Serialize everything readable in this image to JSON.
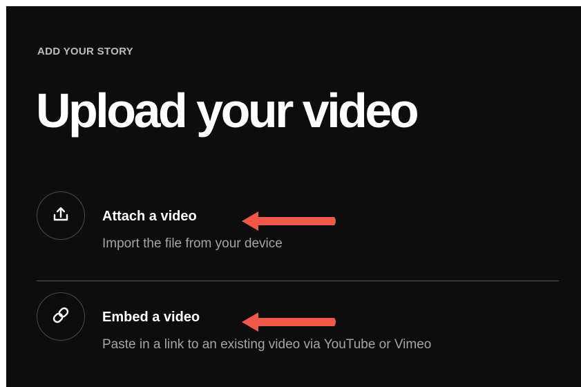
{
  "header": {
    "eyebrow": "ADD YOUR STORY",
    "title": "Upload your video"
  },
  "options": [
    {
      "title": "Attach a video",
      "description": "Import the file from your device",
      "icon": "upload-icon"
    },
    {
      "title": "Embed a video",
      "description": "Paste in a link to an existing video via YouTube or Vimeo",
      "icon": "link-icon"
    }
  ],
  "annotations": {
    "arrow_color": "#f0584a"
  },
  "colors": {
    "background": "#0d0d0d",
    "text_primary": "#ffffff",
    "text_secondary": "#a5a5a5",
    "eyebrow": "#bdbdbd"
  }
}
